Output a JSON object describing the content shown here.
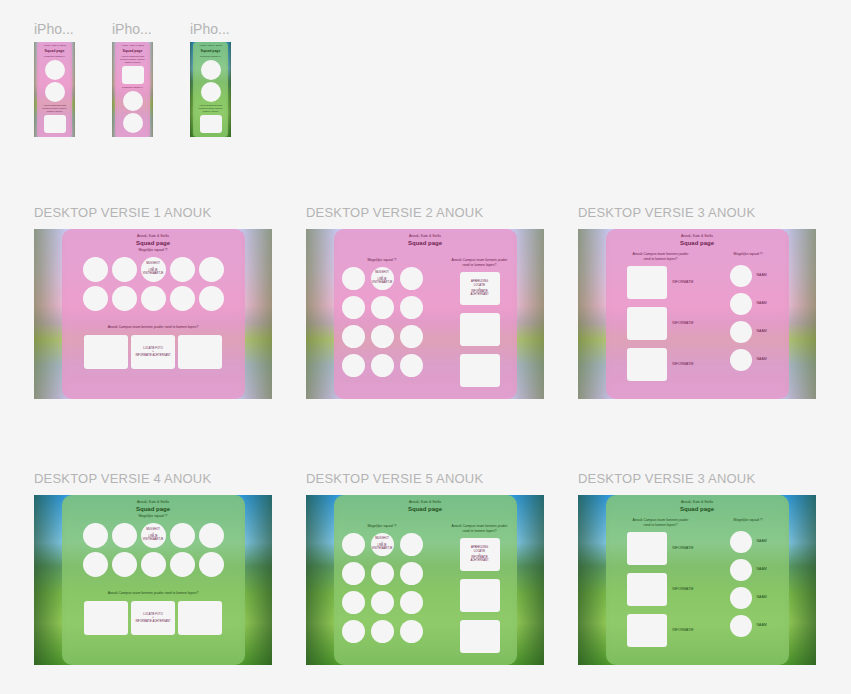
{
  "phones": [
    {
      "label": "iPho...",
      "scene": "pink",
      "owners": "Anouk, Kate & Stella",
      "title": "Squad page",
      "items": [
        {
          "kind": "text",
          "text": "Mogelijke squad !!!"
        },
        {
          "kind": "circle"
        },
        {
          "kind": "circle"
        },
        {
          "kind": "text",
          "text": "Anouk Campus team kennen jouder rond te komen lopen?"
        },
        {
          "kind": "box"
        }
      ]
    },
    {
      "label": "iPho...",
      "scene": "pink",
      "owners": "Anouk, Kate & Stella",
      "title": "Squad page",
      "items": [
        {
          "kind": "text",
          "text": "Anouk Campus team kennen jouder rond te komen lopen?"
        },
        {
          "kind": "box"
        },
        {
          "kind": "text",
          "text": "Mogelijke squad !!!"
        },
        {
          "kind": "circle"
        },
        {
          "kind": "circle"
        }
      ]
    },
    {
      "label": "iPho...",
      "scene": "green",
      "owners": "Anouk, Kate & Stella",
      "title": "Squad page",
      "items": [
        {
          "kind": "text",
          "text": "Mogelijke squad !!!"
        },
        {
          "kind": "circle"
        },
        {
          "kind": "circle"
        },
        {
          "kind": "text",
          "text": "Anouk Campus team kennen jouder rond te komen lopen?"
        },
        {
          "kind": "box"
        }
      ]
    }
  ],
  "desktops": [
    {
      "label": "DESKTOP VERSIE 1 ANOUK",
      "scene": "pink",
      "kind": "grid",
      "owners": "Anouk, Kate & Stella",
      "title": "Squad page",
      "squadLabel": "Mogelijke squad !!!",
      "circles": [
        "",
        "",
        "MUGSHOT\n+\nLINKJE\nVISITEKAARTJE",
        "",
        "",
        "",
        "",
        "",
        "",
        ""
      ],
      "question": "Anouk Campus team kennen jouder rond te komen lopen?",
      "boxes": [
        "",
        "LOCATIE FOTO\n+\nINFORMATIE ACHTERKANT",
        ""
      ]
    },
    {
      "label": "DESKTOP VERSIE 2 ANOUK",
      "scene": "pink",
      "kind": "split",
      "owners": "Anouk, Kate & Stella",
      "title": "Squad page",
      "squadLabel": "Mogelijke squad !!!",
      "circles": [
        "",
        "MUGSHOT\n+\nLINKJE\nVISITEKAARTJE",
        "",
        "",
        "",
        "",
        "",
        "",
        "",
        "",
        "",
        ""
      ],
      "question": "Anouk Campus team kennen jouder rond te komen lopen?",
      "boxes": [
        "AFBEELDING\nLOCATIE\n+\nINFORMATIE\nACHTERKANT",
        "",
        ""
      ]
    },
    {
      "label": "DESKTOP VERSIE 3 ANOUK",
      "scene": "pink",
      "kind": "list",
      "owners": "Anouk, Kate & Stella",
      "title": "Squad page",
      "squadLabel": "Mogelijke squad !!!",
      "circles": [
        "NAAM",
        "NAAM",
        "NAAM",
        "NAAM"
      ],
      "question": "Anouk Campus team kennen jouder rond te komen lopen?",
      "boxes": [
        "INFORMATIE",
        "INFORMATIE",
        "INFORMATIE"
      ]
    },
    {
      "label": "DESKTOP VERSIE 4 ANOUK",
      "scene": "green",
      "kind": "grid",
      "owners": "Anouk, Kate & Stella",
      "title": "Squad page",
      "squadLabel": "Mogelijke squad !!!",
      "circles": [
        "",
        "",
        "MUGSHOT\n+\nLINKJE\nVISITEKAARTJE",
        "",
        "",
        "",
        "",
        "",
        "",
        ""
      ],
      "question": "Anouk Campus team kennen jouder rond te komen lopen?",
      "boxes": [
        "",
        "LOCATIE FOTO\n+\nINFORMATIE ACHTERKANT",
        ""
      ]
    },
    {
      "label": "DESKTOP VERSIE 5 ANOUK",
      "scene": "green",
      "kind": "split",
      "owners": "Anouk, Kate & Stella",
      "title": "Squad page",
      "squadLabel": "Mogelijke squad !!!",
      "circles": [
        "",
        "MUGSHOT\n+\nLINKJE\nVISITEKAARTJE",
        "",
        "",
        "",
        "",
        "",
        "",
        "",
        "",
        "",
        ""
      ],
      "question": "Anouk Campus team kennen jouder rond te komen lopen?",
      "boxes": [
        "AFBEELDING\nLOCATIE\n+\nINFORMATIE\nACHTERKANT",
        "",
        ""
      ]
    },
    {
      "label": "DESKTOP VERSIE 3 ANOUK",
      "scene": "green",
      "kind": "list",
      "owners": "Anouk, Kate & Stella",
      "title": "Squad page",
      "squadLabel": "Mogelijke squad !!!",
      "circles": [
        "NAAM",
        "NAAM",
        "NAAM",
        "NAAM"
      ],
      "question": "Anouk Campus team kennen jouder rond te komen lopen?",
      "boxes": [
        "INFORMATIE",
        "INFORMATIE",
        "INFORMATIE"
      ]
    }
  ]
}
